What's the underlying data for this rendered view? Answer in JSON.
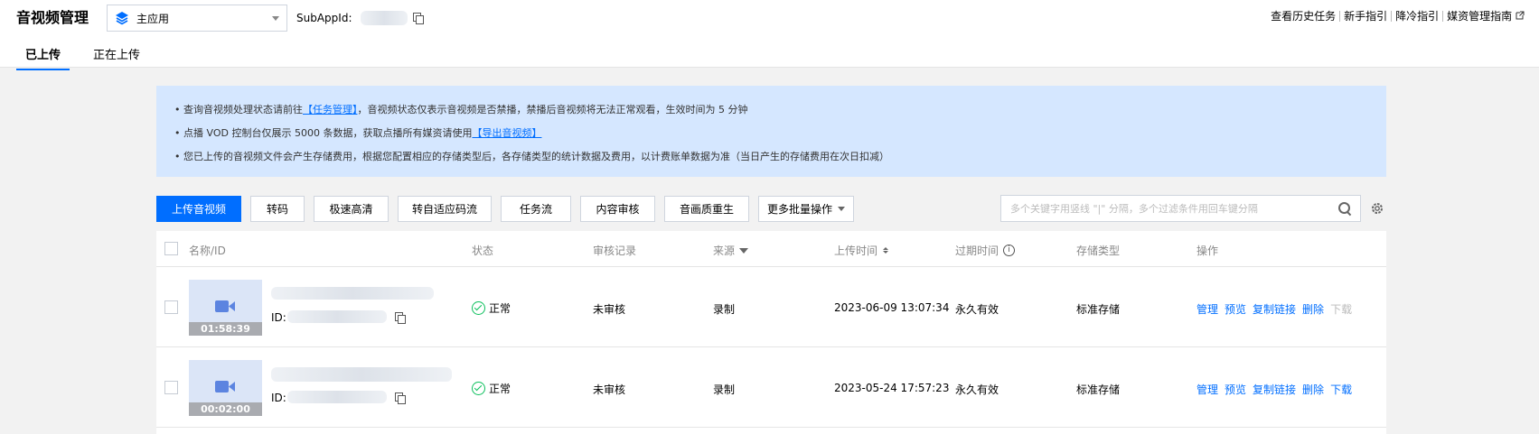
{
  "header": {
    "title": "音视频管理",
    "app_select": "主应用",
    "subappid_label": "SubAppId:",
    "links": [
      "查看历史任务",
      "新手指引",
      "降冷指引",
      "媒资管理指南"
    ]
  },
  "tabs": [
    {
      "label": "已上传",
      "active": true
    },
    {
      "label": "正在上传",
      "active": false
    }
  ],
  "notice": {
    "line1_pre": "查询音视频处理状态请前往",
    "line1_link": "【任务管理】",
    "line1_post": "，音视频状态仅表示音视频是否禁播，禁播后音视频将无法正常观看，生效时间为 5 分钟",
    "line2_pre": "点播 VOD 控制台仅展示 5000 条数据，获取点播所有媒资请使用",
    "line2_link": "【导出音视频】",
    "line3": "您已上传的音视频文件会产生存储费用，根据您配置相应的存储类型后，各存储类型的统计数据及费用，以计费账单数据为准（当日产生的存储费用在次日扣减）"
  },
  "toolbar": {
    "upload": "上传音视频",
    "transcode": "转码",
    "fast_hd": "极速高清",
    "adaptive": "转自适应码流",
    "task_flow": "任务流",
    "review": "内容审核",
    "quality": "音画质重生",
    "more": "更多批量操作",
    "search_placeholder": "多个关键字用竖线 \"|\" 分隔，多个过滤条件用回车键分隔"
  },
  "table": {
    "columns": {
      "name": "名称/ID",
      "status": "状态",
      "audit": "审核记录",
      "source": "来源",
      "upload_time": "上传时间",
      "expire": "过期时间",
      "storage": "存储类型",
      "ops": "操作"
    },
    "rows": [
      {
        "duration": "01:58:39",
        "id_label": "ID:",
        "status": "正常",
        "audit": "未审核",
        "source": "录制",
        "upload_time": "2023-06-09 13:07:34",
        "expire": "永久有效",
        "storage": "标准存储",
        "ops": [
          "管理",
          "预览",
          "复制链接",
          "删除",
          "下载"
        ]
      },
      {
        "duration": "00:02:00",
        "id_label": "ID:",
        "status": "正常",
        "audit": "未审核",
        "source": "录制",
        "upload_time": "2023-05-24 17:57:23",
        "expire": "永久有效",
        "storage": "标准存储",
        "ops": [
          "管理",
          "预览",
          "复制链接",
          "删除",
          "下载"
        ]
      }
    ]
  }
}
